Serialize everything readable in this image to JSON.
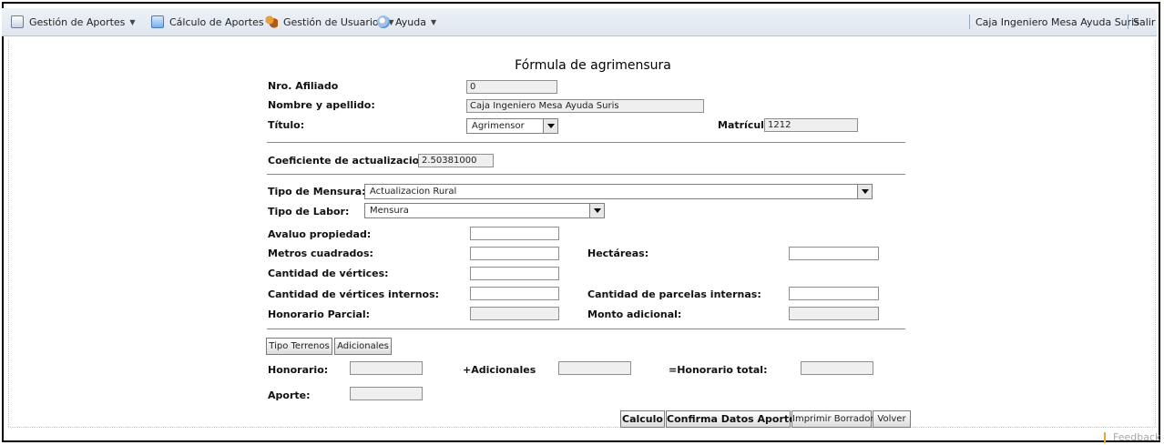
{
  "menu": {
    "items": [
      {
        "label": "Gestión de Aportes",
        "icon": "document-icon"
      },
      {
        "label": "Cálculo de Aportes",
        "icon": "calculator-icon"
      },
      {
        "label": "Gestión de Usuarios",
        "icon": "users-icon"
      },
      {
        "label": "Ayuda",
        "icon": "help-icon"
      }
    ],
    "user": "Caja Ingeniero Mesa Ayuda Suris",
    "logout": "Salir"
  },
  "form": {
    "title": "Fórmula de agrimensura",
    "nro_afiliado": {
      "label": "Nro. Afiliado",
      "value": "0"
    },
    "nombre": {
      "label": "Nombre y apellido:",
      "value": "Caja Ingeniero Mesa Ayuda Suris"
    },
    "titulo": {
      "label": "Título:",
      "value": "Agrimensor"
    },
    "matricula": {
      "label": "Matrícula",
      "value": "1212"
    },
    "coeficiente": {
      "label": "Coeficiente de actualizacion:",
      "value": "2.50381000"
    },
    "tipo_mensura": {
      "label": "Tipo de Mensura:",
      "value": "Actualizacion Rural"
    },
    "tipo_labor": {
      "label": "Tipo de Labor:",
      "value": "Mensura"
    },
    "avaluo": {
      "label": "Avaluo propiedad:",
      "value": ""
    },
    "metros": {
      "label": "Metros cuadrados:",
      "value": ""
    },
    "hectareas": {
      "label": "Hectáreas:",
      "value": ""
    },
    "vertices": {
      "label": "Cantidad de vértices:",
      "value": ""
    },
    "vertices_internos": {
      "label": "Cantidad de vértices internos:",
      "value": ""
    },
    "parcelas_internas": {
      "label": "Cantidad de parcelas internas:",
      "value": ""
    },
    "honorario_parcial": {
      "label": "Honorario Parcial:",
      "value": ""
    },
    "monto_adicional": {
      "label": "Monto adicional:",
      "value": ""
    },
    "tabs": {
      "terrenos": "Tipo Terrenos",
      "adicionales": "Adicionales"
    },
    "honorario": {
      "label": "Honorario:",
      "value": ""
    },
    "adicionales": {
      "label": "+Adicionales",
      "value": ""
    },
    "honorario_total": {
      "label": "=Honorario total:",
      "value": ""
    },
    "aporte": {
      "label": "Aporte:",
      "value": ""
    }
  },
  "buttons": {
    "calculo": "Calculo",
    "confirma": "Confirma Datos Aporte",
    "imprimir": "Imprimir Borrador",
    "volver": "Volver"
  },
  "footer": {
    "feedback": "Feedback"
  }
}
